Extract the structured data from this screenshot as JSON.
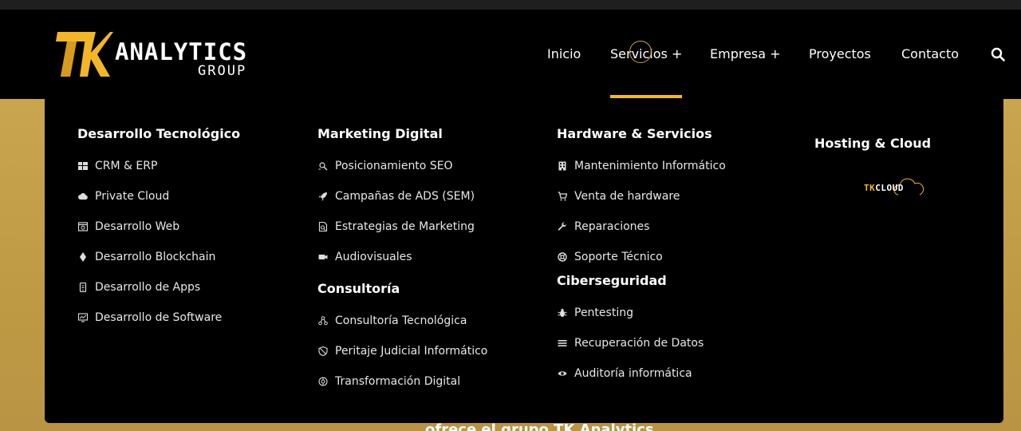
{
  "brand": {
    "logo_mark": "TK",
    "logo_word": "ANALYTICS",
    "logo_sub": "GROUP",
    "accent_color": "#f2b62a"
  },
  "nav": {
    "items": [
      "Inicio",
      "Servicios +",
      "Empresa +",
      "Proyectos",
      "Contacto"
    ],
    "active_index": 1,
    "search_icon": "search-icon"
  },
  "hero": {
    "partial_text": "ofrece el grupo TK Analytics"
  },
  "mega_menu": {
    "columns": [
      {
        "sections": [
          {
            "title": "Desarrollo Tecnológico",
            "items": [
              {
                "label": "CRM & ERP",
                "icon": "grid-icon"
              },
              {
                "label": "Private Cloud",
                "icon": "cloud-icon"
              },
              {
                "label": "Desarrollo Web",
                "icon": "web-window-icon"
              },
              {
                "label": "Desarrollo Blockchain",
                "icon": "ethereum-icon"
              },
              {
                "label": "Desarrollo de Apps",
                "icon": "mobile-icon"
              },
              {
                "label": "Desarrollo de Software",
                "icon": "monitor-chart-icon"
              }
            ]
          }
        ]
      },
      {
        "sections": [
          {
            "title": "Marketing Digital",
            "items": [
              {
                "label": "Posicionamiento SEO",
                "icon": "seo-search-icon"
              },
              {
                "label": "Campañas de ADS (SEM)",
                "icon": "rocket-icon"
              },
              {
                "label": "Estrategias de Marketing",
                "icon": "document-search-icon"
              },
              {
                "label": "Audiovisuales",
                "icon": "video-camera-icon"
              }
            ]
          },
          {
            "title": "Consultoría",
            "items": [
              {
                "label": "Consultoría Tecnológica",
                "icon": "people-network-icon"
              },
              {
                "label": "Peritaje Judicial Informático",
                "icon": "shield-slash-icon"
              },
              {
                "label": "Transformación Digital",
                "icon": "digital-transform-icon"
              }
            ]
          }
        ]
      },
      {
        "sections": [
          {
            "title": "Hardware & Servicios",
            "items": [
              {
                "label": "Mantenimiento Informático",
                "icon": "building-icon"
              },
              {
                "label": "Venta de hardware",
                "icon": "cart-icon"
              },
              {
                "label": "Reparaciones",
                "icon": "wrench-icon"
              },
              {
                "label": "Soporte Técnico",
                "icon": "lifebuoy-icon"
              }
            ]
          },
          {
            "title": "Ciberseguridad",
            "items": [
              {
                "label": "Pentesting",
                "icon": "bug-icon"
              },
              {
                "label": "Recuperación de Datos",
                "icon": "list-icon"
              },
              {
                "label": "Auditoría informática",
                "icon": "eye-icon"
              }
            ]
          }
        ]
      },
      {
        "sections": [
          {
            "title": "Hosting & Cloud",
            "logo_tk": "TK",
            "logo_cloud": "CLOUD"
          }
        ]
      }
    ]
  }
}
